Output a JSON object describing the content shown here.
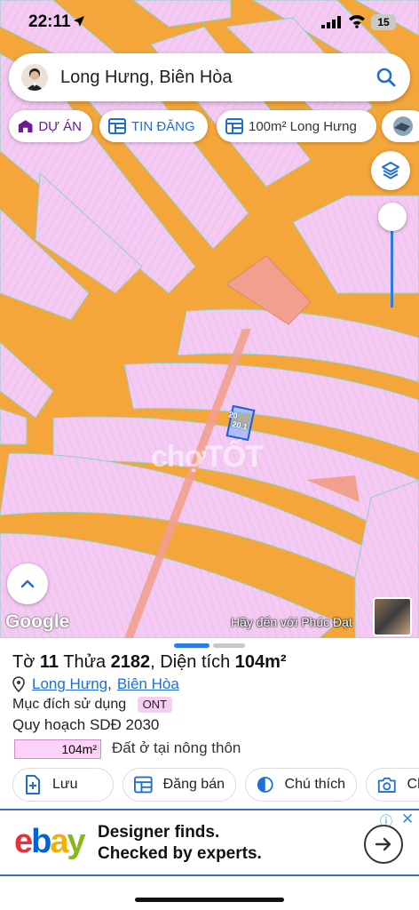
{
  "status_bar": {
    "time": "22:11",
    "battery": "15"
  },
  "search": {
    "query": "Long Hưng, Biên Hòa"
  },
  "chips": [
    {
      "label": "DỰ ÁN",
      "icon": "home-icon",
      "color": "#6a1b9a"
    },
    {
      "label": "TIN ĐĂNG",
      "icon": "listing-icon",
      "color": "#1e6fd0"
    },
    {
      "label": "100m² Long Hưng",
      "icon": "listing-icon",
      "color": "#333333"
    },
    {
      "label": "",
      "icon": "thumbnail-icon"
    }
  ],
  "map": {
    "road_color": "#f4a63a",
    "lot_color": "#f7c9f2",
    "watermark": "chợTỐT",
    "google_logo": "Google",
    "promo_text": "Hãy đến với Phúc Đạt",
    "plot_label_a": "20",
    "plot_label_b": "20.1"
  },
  "parcel": {
    "title_prefix": "Tờ ",
    "sheet": "11",
    "parcel_label": " Thửa ",
    "parcel_no": "2182",
    "area_label": ", Diện tích ",
    "area": "104m²",
    "ward": "Long Hưng",
    "separator": ",",
    "city": "Biên Hòa",
    "purpose_label": "Mục đích sử dụng",
    "purpose_code": "ONT",
    "plan_label": "Quy hoạch SDĐ 2030",
    "plan_area": "104m²",
    "plan_desc": "Đất ở tại nông thôn"
  },
  "actions": [
    {
      "label": "Lưu",
      "icon": "add-note-icon"
    },
    {
      "label": "Đăng bán",
      "icon": "listing-icon"
    },
    {
      "label": "Chú thích",
      "icon": "legend-icon"
    },
    {
      "label": "Ch",
      "icon": "camera-add-icon"
    }
  ],
  "ad": {
    "brand": "ebay",
    "line1": "Designer finds.",
    "line2": "Checked by experts.",
    "info": "ⓘ",
    "close": "✕"
  }
}
